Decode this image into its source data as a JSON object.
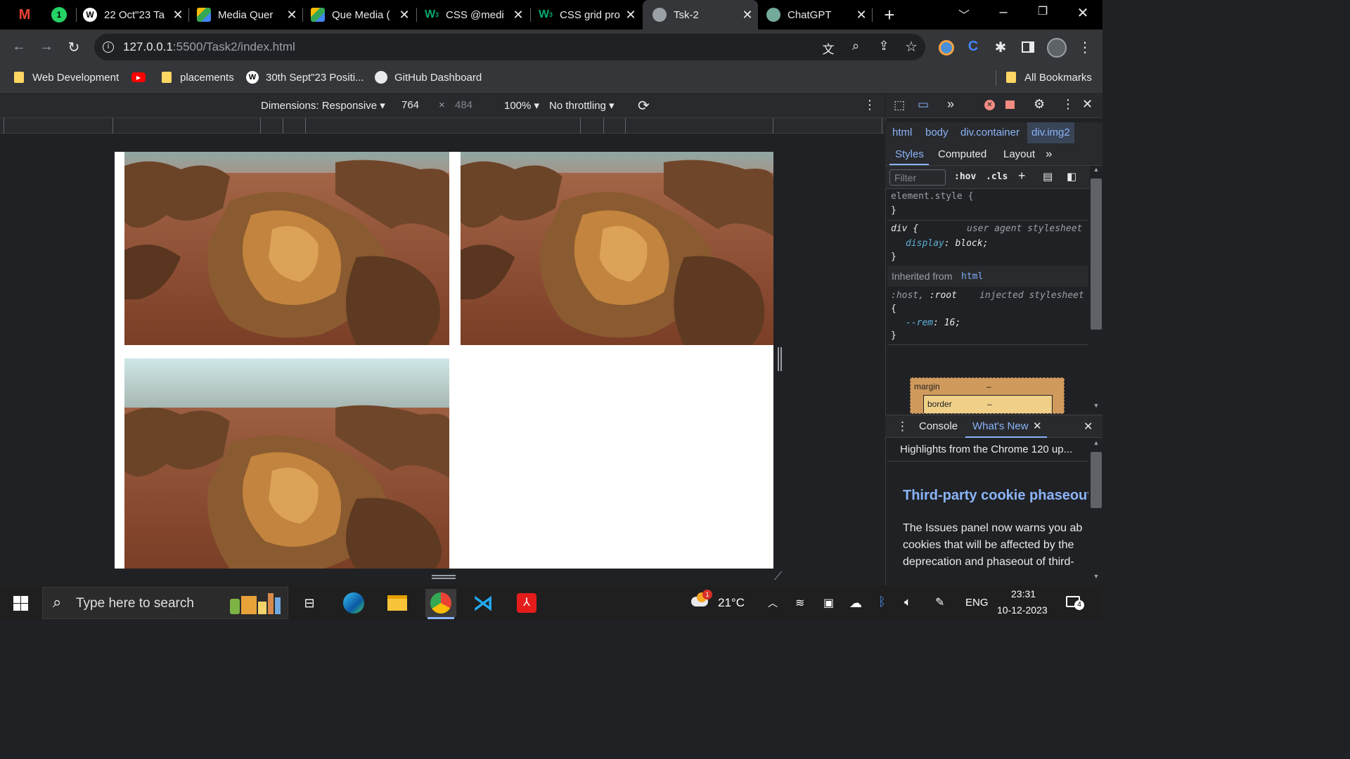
{
  "tabs": [
    {
      "title": "",
      "icon": "gmail-icon"
    },
    {
      "title": "",
      "icon": "whatsapp-icon"
    },
    {
      "title": "22 Oct\"23 Ta",
      "icon": "wordpress-icon"
    },
    {
      "title": "Media Quer",
      "icon": "google-drive-icon"
    },
    {
      "title": "Que Media (",
      "icon": "google-drive-icon"
    },
    {
      "title": "CSS @medi",
      "icon": "w3schools-icon"
    },
    {
      "title": "CSS grid pro",
      "icon": "w3schools-icon"
    },
    {
      "title": "Tsk-2",
      "icon": "globe-icon",
      "active": true
    },
    {
      "title": "ChatGPT",
      "icon": "chatgpt-icon"
    }
  ],
  "address": {
    "host": "127.0.0.1",
    "rest": ":5500/Task2/index.html"
  },
  "bookmarks": [
    {
      "label": "Web Development",
      "icon": "folder-icon"
    },
    {
      "label": "",
      "icon": "youtube-icon"
    },
    {
      "label": "placements",
      "icon": "folder-icon"
    },
    {
      "label": "30th Sept\"23 Positi...",
      "icon": "wordpress-icon"
    },
    {
      "label": "GitHub Dashboard",
      "icon": "github-icon"
    },
    {
      "label": "All Bookmarks",
      "icon": "folder-icon"
    }
  ],
  "device_toolbar": {
    "dimensions": "Dimensions: Responsive",
    "width": "764",
    "times": "×",
    "height": "484",
    "zoom": "100%",
    "throttling": "No throttling"
  },
  "devtools": {
    "breadcrumb": [
      "html",
      "body",
      "div.container",
      "div.img2"
    ],
    "tabs": [
      "Styles",
      "Computed",
      "Layout"
    ],
    "filter_placeholder": "Filter",
    "hov": ":hov",
    "cls": ".cls",
    "rules": {
      "element_style": "element.style {",
      "close": "}",
      "div_selector": "div {",
      "div_source": "user agent stylesheet",
      "div_prop": "display",
      "div_val": "block;",
      "inherited_label": "Inherited from",
      "inherited_from": "html",
      "host_selector_a": ":host,",
      "host_selector_b": ":root",
      "host_source": "injected stylesheet",
      "open": "{",
      "rem_prop": "--rem",
      "rem_val": "16;"
    },
    "boxmodel": {
      "margin": "margin",
      "border": "border",
      "dash": "–"
    },
    "drawer": {
      "tabs": [
        "Console",
        "What's New"
      ],
      "highlights": "Highlights from the Chrome 120 up...",
      "heading": "Third-party cookie phaseout",
      "body": "The Issues panel now warns you ab cookies that will be affected by the deprecation and phaseout of third-"
    }
  },
  "taskbar": {
    "search_placeholder": "Type here to search",
    "weather_temp": "21°C",
    "weather_badge": "1",
    "language": "ENG",
    "time": "23:31",
    "date": "10-12-2023",
    "notification_count": "4"
  },
  "colors": {
    "accent_blue": "#8ab4f8",
    "devtools_link": "#7cacf8",
    "heading_blue": "#8ab4f8"
  }
}
